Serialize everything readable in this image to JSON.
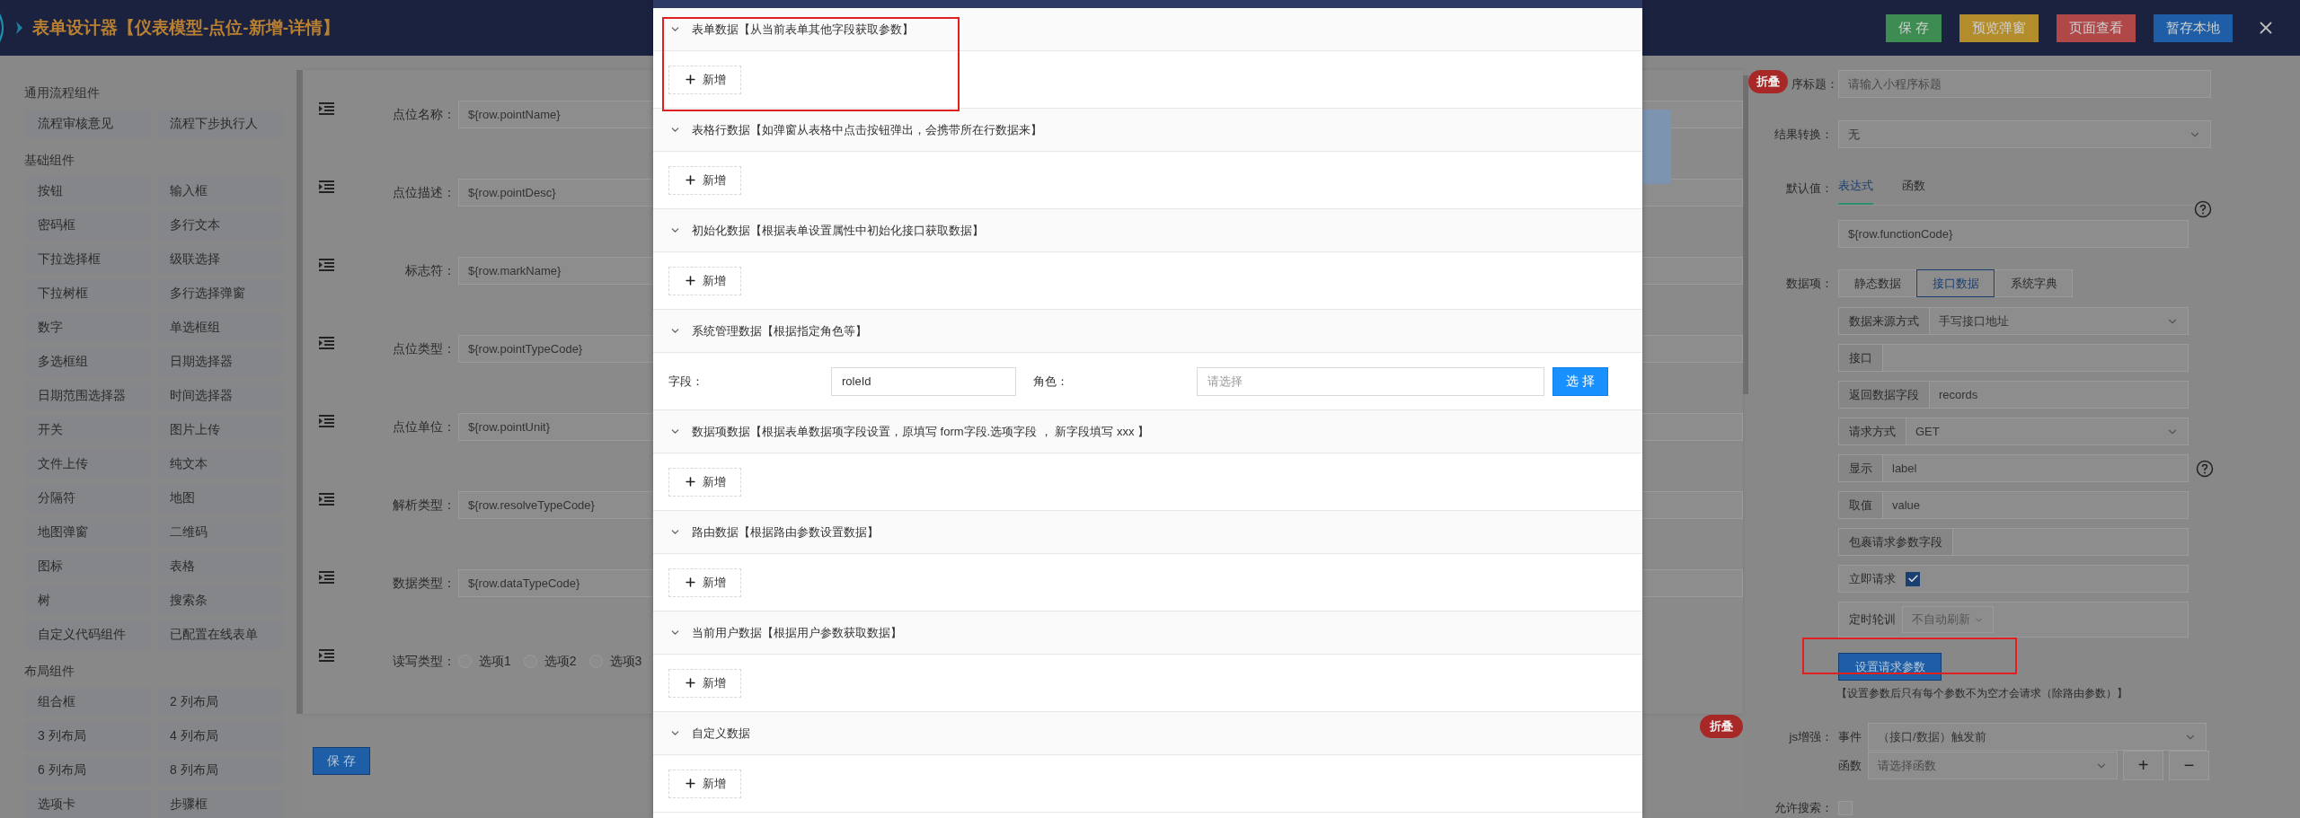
{
  "header": {
    "title": "表单设计器【仪表模型-点位-新增-详情】",
    "buttons": [
      {
        "label": "保 存",
        "color": "#3d8c52"
      },
      {
        "label": "预览弹窗",
        "color": "#b38d2c"
      },
      {
        "label": "页面查看",
        "color": "#b04848"
      },
      {
        "label": "暂存本地",
        "color": "#1d5ea6"
      }
    ]
  },
  "palette": {
    "groups": [
      {
        "title": "通用流程组件",
        "items": [
          "流程审核意见",
          "流程下步执行人"
        ]
      },
      {
        "title": "基础组件",
        "items": [
          "按钮",
          "输入框",
          "密码框",
          "多行文本",
          "下拉选择框",
          "级联选择",
          "下拉树框",
          "多行选择弹窗",
          "数字",
          "单选框组",
          "多选框组",
          "日期选择器",
          "日期范围选择器",
          "时间选择器",
          "开关",
          "图片上传",
          "文件上传",
          "纯文本",
          "分隔符",
          "地图",
          "地图弹窗",
          "二维码",
          "图标",
          "表格",
          "树",
          "搜索条",
          "自定义代码组件",
          "已配置在线表单"
        ]
      },
      {
        "title": "布局组件",
        "items": [
          "组合框",
          "2 列布局",
          "3 列布局",
          "4 列布局",
          "6 列布局",
          "8 列布局",
          "选项卡",
          "步骤框"
        ]
      }
    ]
  },
  "canvas": {
    "rows": [
      {
        "kind": "input",
        "label": "点位名称：",
        "value": "${row.pointName}"
      },
      {
        "kind": "input",
        "label": "点位描述：",
        "value": "${row.pointDesc}"
      },
      {
        "kind": "input",
        "label": "标志符：",
        "value": "${row.markName}"
      },
      {
        "kind": "input",
        "label": "点位类型：",
        "value": "${row.pointTypeCode}"
      },
      {
        "kind": "input",
        "label": "点位单位：",
        "value": "${row.pointUnit}"
      },
      {
        "kind": "input",
        "label": "解析类型：",
        "value": "${row.resolveTypeCode}"
      },
      {
        "kind": "input",
        "label": "数据类型：",
        "value": "${row.dataTypeCode}"
      },
      {
        "kind": "radio",
        "label": "读写类型：",
        "options": [
          {
            "label": "选项1",
            "selected": false
          },
          {
            "label": "选项2",
            "selected": false
          },
          {
            "label": "选项3",
            "selected": false
          }
        ]
      }
    ],
    "save_button": "保 存",
    "collapse_badge": "折叠"
  },
  "modal": {
    "sections": [
      {
        "kind": "add",
        "expanded": true,
        "title": "表单数据【从当前表单其他字段获取参数】",
        "button": "新增"
      },
      {
        "kind": "add",
        "expanded": true,
        "title": "表格行数据【如弹窗从表格中点击按钮弹出，会携带所在行数据来】",
        "button": "新增"
      },
      {
        "kind": "add",
        "expanded": true,
        "title": "初始化数据【根据表单设置属性中初始化接口获取数据】",
        "button": "新增"
      },
      {
        "kind": "fields",
        "expanded": true,
        "title": "系统管理数据【根据指定角色等】",
        "field_label": "字段：",
        "field_value": "roleId",
        "role_label": "角色：",
        "role_placeholder": "请选择",
        "button": "选 择"
      },
      {
        "kind": "add",
        "expanded": true,
        "title": "数据项数据【根据表单数据项字段设置，原填写 form字段.选项字段 ， 新字段填写 xxx 】",
        "button": "新增"
      },
      {
        "kind": "add",
        "expanded": true,
        "title": "路由数据【根据路由参数设置数据】",
        "button": "新增"
      },
      {
        "kind": "add",
        "expanded": true,
        "title": "当前用户数据【根据用户参数获取数据】",
        "button": "新增"
      },
      {
        "kind": "add",
        "expanded": true,
        "title": "自定义数据",
        "button": "新增"
      }
    ]
  },
  "properties": {
    "collapse_badge": "折叠",
    "title_field": {
      "label": "序标题：",
      "placeholder": "请输入小程序标题"
    },
    "result_field": {
      "label": "结果转换：",
      "value": "无"
    },
    "default_value": {
      "label": "默认值：",
      "tabs": [
        {
          "label": "表达式",
          "selected": true
        },
        {
          "label": "函数",
          "selected": false
        }
      ],
      "value": "${row.functionCode}"
    },
    "data_items": {
      "label": "数据项：",
      "options": [
        {
          "label": "静态数据",
          "selected": false
        },
        {
          "label": "接口数据",
          "selected": true
        },
        {
          "label": "系统字典",
          "selected": false
        }
      ],
      "groups": [
        {
          "kind": "select",
          "addon": "数据来源方式",
          "value": "手写接口地址"
        },
        {
          "kind": "input",
          "addon": "接口"
        },
        {
          "kind": "input",
          "addon": "返回数据字段",
          "value": "records"
        },
        {
          "kind": "select",
          "addon": "请求方式",
          "value": "GET"
        },
        {
          "kind": "input",
          "addon": "显示",
          "value": "label",
          "help": true
        },
        {
          "kind": "input",
          "addon": "取值",
          "value": "value"
        },
        {
          "kind": "input",
          "addon": "包裹请求参数字段"
        },
        {
          "kind": "checkbox",
          "addon": "立即请求",
          "checked": true
        },
        {
          "kind": "mini_select",
          "addon": "定时轮训",
          "value": "不自动刷新"
        }
      ],
      "params_button": "设置请求参数",
      "note": "【设置参数后只有每个参数不为空才会请求（除路由参数）】"
    },
    "js": {
      "label": "js增强：",
      "event_label": "事件",
      "event_value": "（接口/数据）触发前",
      "function_label": "函数",
      "function_placeholder": "请选择函数",
      "add": "+",
      "remove": "−"
    },
    "search": {
      "label": "允许搜索：",
      "checked": false
    }
  }
}
